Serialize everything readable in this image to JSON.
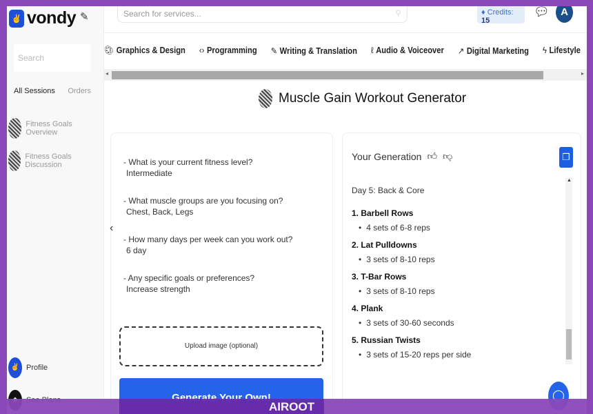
{
  "sidebar": {
    "logo": "vondy",
    "search_placeholder": "Search",
    "tabs": [
      "All Sessions",
      "Orders"
    ],
    "sessions": [
      "Fitness Goals Overview",
      "Fitness Goals Discussion"
    ],
    "profile": "Profile",
    "see_plans": "See Plans"
  },
  "header": {
    "search_placeholder": "Search for services...",
    "credits_label": "Credits:",
    "credits_value": "15",
    "avatar": "A"
  },
  "categories": [
    {
      "label": "Graphics & Design",
      "icon": "palette-icon",
      "glyph": "🎨︎"
    },
    {
      "label": "Programming",
      "icon": "code-icon",
      "glyph": "‹›"
    },
    {
      "label": "Writing & Translation",
      "icon": "pen-icon",
      "glyph": "✎"
    },
    {
      "label": "Audio & Voiceover",
      "icon": "mic-icon",
      "glyph": "ℓ"
    },
    {
      "label": "Digital Marketing",
      "icon": "trend-icon",
      "glyph": "↗"
    },
    {
      "label": "Lifestyle",
      "icon": "bolt-icon",
      "glyph": "ϟ"
    }
  ],
  "page": {
    "title": "Muscle Gain Workout Generator"
  },
  "form": {
    "qa": [
      {
        "q": "- What is your current fitness level?",
        "a": "Intermediate"
      },
      {
        "q": "- What muscle groups are you focusing on?",
        "a": "Chest, Back, Legs"
      },
      {
        "q": "- How many days per week can you work out?",
        "a": "6 day"
      },
      {
        "q": "- Any specific goals or preferences?",
        "a": "Increase strength"
      }
    ],
    "upload": "Upload image (optional)",
    "generate": "Generate Your Own!"
  },
  "output": {
    "title": "Your Generation",
    "day": "Day 5: Back & Core",
    "items": [
      {
        "h": "1. Barbell Rows",
        "p": "4 sets of 6-8 reps"
      },
      {
        "h": "2. Lat Pulldowns",
        "p": "3 sets of 8-10 reps"
      },
      {
        "h": "3. T-Bar Rows",
        "p": "3 sets of 8-10 reps"
      },
      {
        "h": "4. Plank",
        "p": "3 sets of 30-60 seconds"
      },
      {
        "h": "5. Russian Twists",
        "p": "3 sets of 15-20 reps per side"
      }
    ]
  },
  "watermark": "AIROOT"
}
